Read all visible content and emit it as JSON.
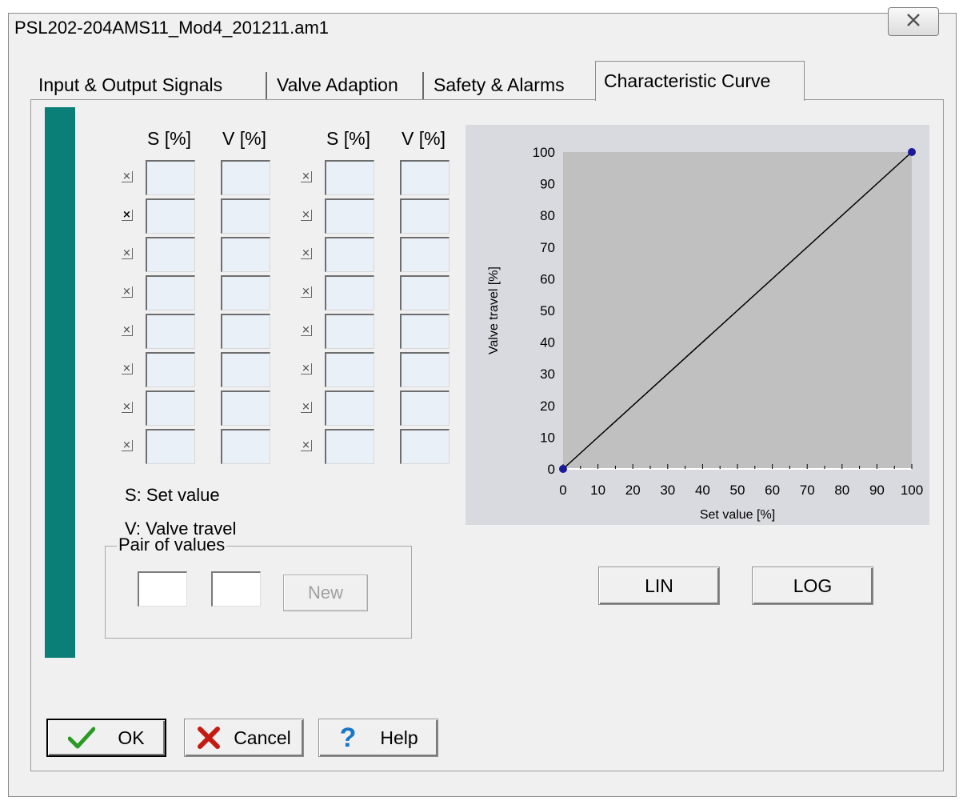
{
  "window": {
    "title": "PSL202-204AMS11_Mod4_201211.am1"
  },
  "tabs": [
    {
      "label": "Input & Output Signals"
    },
    {
      "label": "Valve Adaption"
    },
    {
      "label": "Safety & Alarms"
    },
    {
      "label": "Characteristic Curve"
    }
  ],
  "table": {
    "headers": [
      "S [%]",
      "V [%]",
      "S [%]",
      "V [%]"
    ],
    "rows": 8,
    "checked_row": 2
  },
  "legend": {
    "s": "S: Set value",
    "v": "V: Valve travel"
  },
  "pair": {
    "title": "Pair of values",
    "new_label": "New"
  },
  "chart_data": {
    "type": "line",
    "xlabel": "Set value [%]",
    "ylabel": "Valve travel [%]",
    "xlim": [
      0,
      100
    ],
    "ylim": [
      0,
      100
    ],
    "xticks": [
      "0",
      "10",
      "20",
      "30",
      "40",
      "50",
      "60",
      "70",
      "80",
      "90",
      "100"
    ],
    "yticks": [
      "0",
      "10",
      "20",
      "30",
      "40",
      "50",
      "60",
      "70",
      "80",
      "90",
      "100"
    ],
    "series": [
      {
        "x": [
          0,
          100
        ],
        "y": [
          0,
          100
        ]
      }
    ],
    "points": [
      {
        "x": 0,
        "y": 0
      },
      {
        "x": 100,
        "y": 100
      }
    ],
    "plot_bg": "#c0c0c0",
    "point_color": "#1a1a9a"
  },
  "curve_buttons": {
    "lin": "LIN",
    "log": "LOG"
  },
  "footer": {
    "ok": "OK",
    "cancel": "Cancel",
    "help": "Help"
  },
  "colors": {
    "accent_bar": "#0a7f77"
  }
}
